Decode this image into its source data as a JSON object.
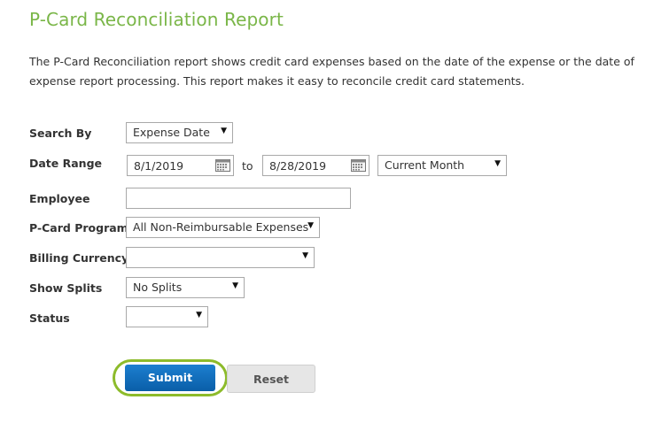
{
  "page": {
    "title": "P-Card Reconciliation Report",
    "description": "The P-Card Reconciliation report shows credit card expenses based on the date of the expense or the date of expense report processing. This report makes it easy to reconcile credit card statements."
  },
  "form": {
    "search_by": {
      "label": "Search By",
      "value": "Expense Date"
    },
    "date_range": {
      "label": "Date Range",
      "start": "8/1/2019",
      "to_text": "to",
      "end": "8/28/2019",
      "preset": "Current Month"
    },
    "employee": {
      "label": "Employee",
      "value": ""
    },
    "pcard_program": {
      "label": "P-Card Program",
      "value": "All Non-Reimbursable Expenses"
    },
    "billing_currency": {
      "label": "Billing Currency",
      "value": ""
    },
    "show_splits": {
      "label": "Show Splits",
      "value": "No Splits"
    },
    "status": {
      "label": "Status",
      "value": ""
    }
  },
  "buttons": {
    "submit_label": "Submit",
    "reset_label": "Reset"
  },
  "icons": {
    "dropdown": "chevron-down-icon",
    "calendar": "calendar-icon"
  },
  "colors": {
    "title": "#7ab648",
    "submit_bg": "#0a6cbf",
    "highlight_ring": "#8dbb2b",
    "reset_bg": "#e6e6e6"
  }
}
